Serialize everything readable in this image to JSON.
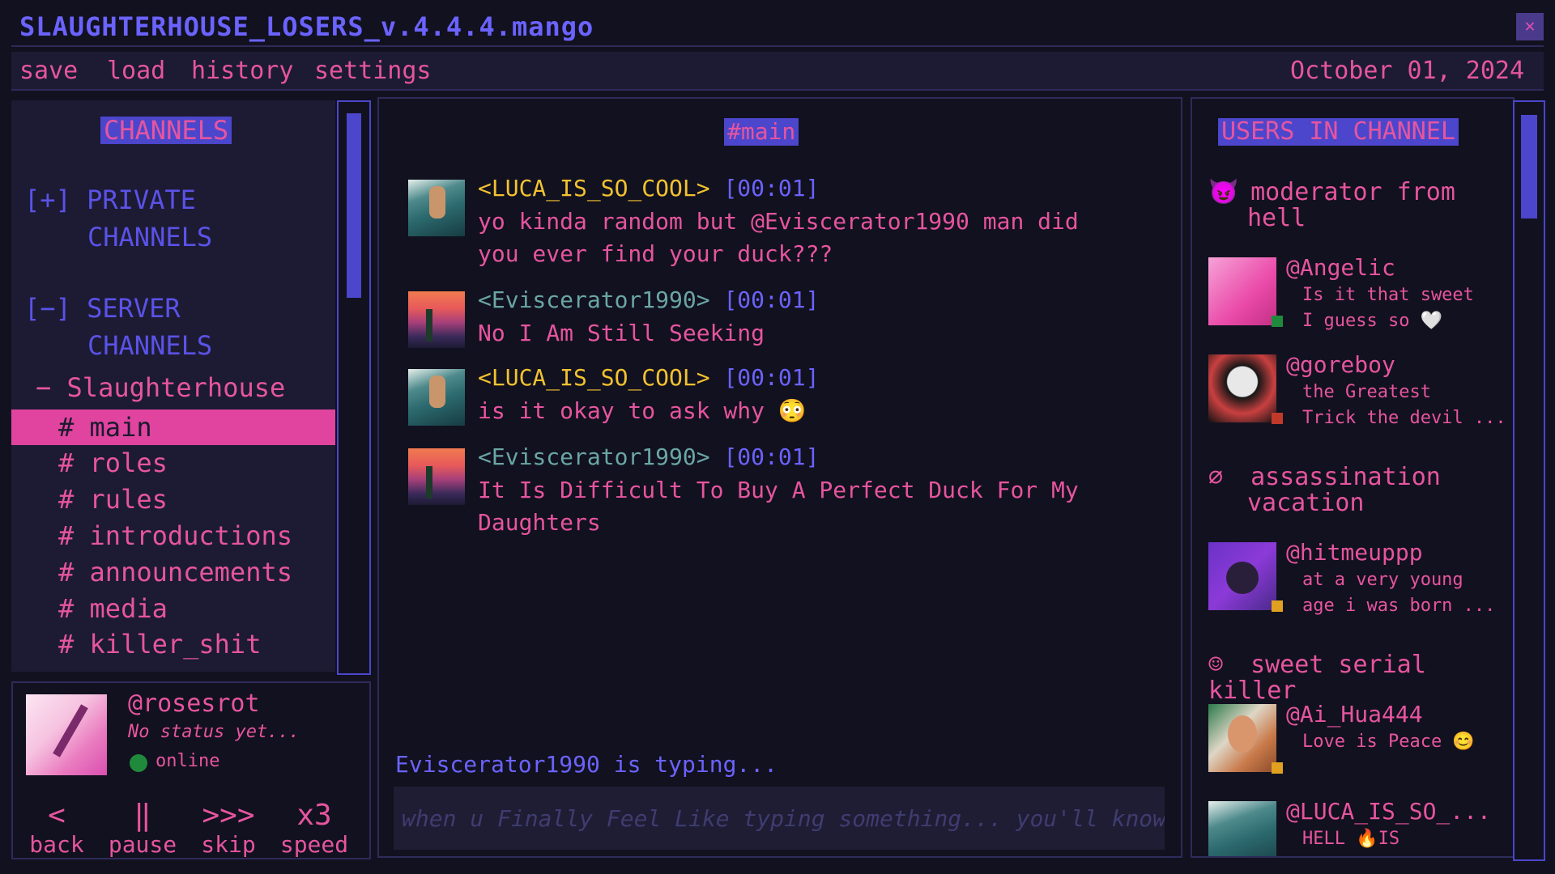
{
  "app": {
    "title": "SLAUGHTERHOUSE_LOSERS_v.4.4.4.mango",
    "close_icon": "close-icon"
  },
  "menu": {
    "items": [
      "save",
      "load",
      "history",
      "settings"
    ],
    "date": "October 01, 2024"
  },
  "channels": {
    "heading": "CHANNELS",
    "private_group_1": "[+] PRIVATE",
    "private_group_2": "CHANNELS",
    "server_group_1": "[−] SERVER",
    "server_group_2": "CHANNELS",
    "server_name": "− Slaughterhouse",
    "list": [
      "# main",
      "# roles",
      "# rules",
      "# introductions",
      "# announcements",
      "# media",
      "# killer_shit"
    ],
    "active": "# main"
  },
  "profile": {
    "handle": "@rosesrot",
    "status": "No status yet...",
    "presence": "online",
    "presence_color": "#1f8a3b"
  },
  "controls": [
    {
      "symbol": "<",
      "label": "back"
    },
    {
      "symbol": "‖",
      "label": "pause"
    },
    {
      "symbol": ">>>",
      "label": "skip"
    },
    {
      "symbol": "x3",
      "label": "speed"
    }
  ],
  "chat": {
    "channel": "#main",
    "messages": [
      {
        "author": "<LUCA_IS_SO_COOL>",
        "time": "[00:01]",
        "line1": "yo kinda random but @Eviscerator1990 man did",
        "line2": "you ever find your duck???"
      },
      {
        "author": "<Eviscerator1990>",
        "time": "[00:01]",
        "line1": "No I Am Still Seeking",
        "line2": ""
      },
      {
        "author": "<LUCA_IS_SO_COOL>",
        "time": "[00:01]",
        "line1": "is it okay to ask why 😳",
        "line2": ""
      },
      {
        "author": "<Eviscerator1990>",
        "time": "[00:01]",
        "line1": "It Is Difficult To Buy A Perfect Duck For My",
        "line2": "Daughters"
      }
    ],
    "typing": "Eviscerator1990 is typing...",
    "input_placeholder": "when u Finally Feel Like typing something... you'll know"
  },
  "users": {
    "heading": "USERS IN CHANNEL",
    "roles": [
      {
        "icon": "😈",
        "line1": "moderator from",
        "line2": "hell"
      },
      {
        "icon": "∅",
        "line1": "assassination",
        "line2": "vacation"
      },
      {
        "icon": "☺",
        "line1": "sweet serial killer",
        "line2": ""
      }
    ],
    "members": [
      {
        "name": "@Angelic",
        "l1": "Is it that sweet",
        "l2": "I guess so 🤍",
        "dot": "#1f8a3b"
      },
      {
        "name": "@goreboy",
        "l1": "the Greatest",
        "l2": "Trick the devil ...",
        "dot": "#c0392b"
      },
      {
        "name": "@hitmeuppp",
        "l1": "at a very young",
        "l2": "age i was born ...",
        "dot": "#e0a020"
      },
      {
        "name": "@Ai_Hua444",
        "l1": "Love is Peace 😊",
        "l2": "",
        "dot": "#e0a020"
      },
      {
        "name": "@LUCA_IS_SO_...",
        "l1": "HELL 🔥IS",
        "l2": "",
        "dot": ""
      }
    ]
  },
  "colors": {
    "accent_pink": "#e6559f",
    "accent_purple": "#4b46cc",
    "background": "#12111f"
  }
}
